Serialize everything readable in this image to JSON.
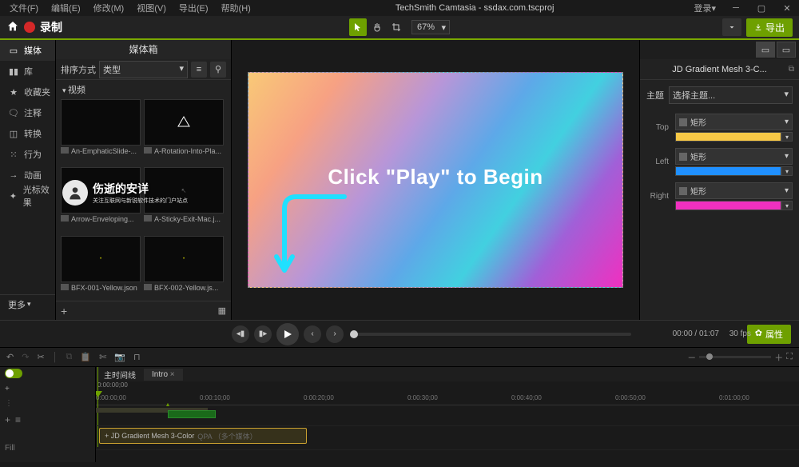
{
  "titlebar": {
    "menus": [
      "文件(F)",
      "编辑(E)",
      "修改(M)",
      "视图(V)",
      "导出(E)",
      "帮助(H)"
    ],
    "title": "TechSmith Camtasia - ssdax.com.tscproj",
    "login": "登录▾"
  },
  "record": {
    "label": "录制",
    "zoom": "67%",
    "export": "导出"
  },
  "leftnav": {
    "items": [
      "媒体",
      "库",
      "收藏夹",
      "注释",
      "转换",
      "行为",
      "动画",
      "光标效果"
    ],
    "more": "更多"
  },
  "mediabin": {
    "title": "媒体箱",
    "sort_label": "排序方式",
    "sort_value": "类型",
    "section": "视频",
    "thumbs": [
      "An-EmphaticSlide-...",
      "A-Rotation-Into-Pla...",
      "Arrow-Enveloping...",
      "A-Sticky-Exit-Mac.j...",
      "BFX-001-Yellow.json",
      "BFX-002-Yellow.js..."
    ]
  },
  "watermark": {
    "name": "伤逝的安详",
    "sub": "关注互联网与新锐软件技术的门户站点"
  },
  "canvas": {
    "text": "Click \"Play\" to Begin"
  },
  "props": {
    "title": "JD Gradient Mesh 3-C...",
    "theme_label": "主题",
    "theme_value": "选择主题...",
    "rows": [
      {
        "label": "Top",
        "shape": "矩形",
        "color": "#f7c846"
      },
      {
        "label": "Left",
        "shape": "矩形",
        "color": "#2090ff"
      },
      {
        "label": "Right",
        "shape": "矩形",
        "color": "#f030c0"
      }
    ]
  },
  "playback": {
    "time": "00:00 / 01:07",
    "fps": "30 fps",
    "props_btn": "属性"
  },
  "timeline": {
    "tabs": [
      "主时间线",
      "Intro"
    ],
    "timestamp": "0:00:00;00",
    "ruler": [
      "0:00:00;00",
      "0:00:10;00",
      "0:00:20;00",
      "0:00:30;00",
      "0:00:40;00",
      "0:00:50;00",
      "0:01:00;00"
    ],
    "fill": "Fill",
    "clip": "+ JD Gradient Mesh 3-Color",
    "clip_suffix": "QPA （多个媒体）"
  }
}
